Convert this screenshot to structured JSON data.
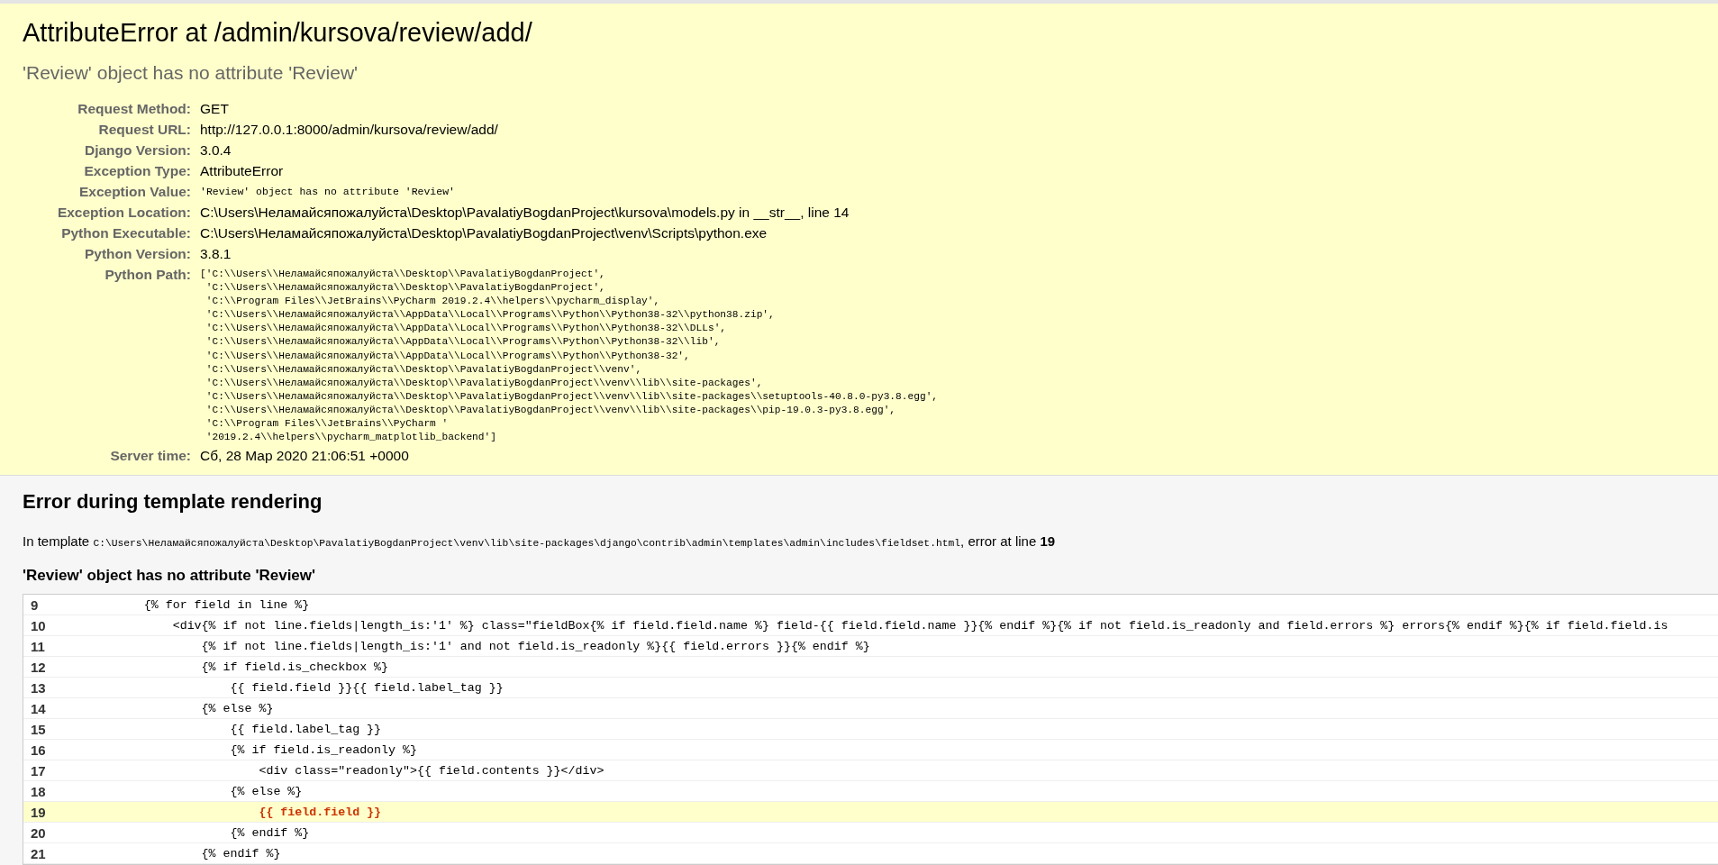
{
  "summary": {
    "title": "AttributeError at /admin/kursova/review/add/",
    "subtitle": "'Review' object has no attribute 'Review'",
    "meta": [
      {
        "label": "Request Method:",
        "kind": "text",
        "value": "GET"
      },
      {
        "label": "Request URL:",
        "kind": "text",
        "value": "http://127.0.0.1:8000/admin/kursova/review/add/"
      },
      {
        "label": "Django Version:",
        "kind": "text",
        "value": "3.0.4"
      },
      {
        "label": "Exception Type:",
        "kind": "text",
        "value": "AttributeError"
      },
      {
        "label": "Exception Value:",
        "kind": "code",
        "value": "'Review' object has no attribute 'Review'"
      },
      {
        "label": "Exception Location:",
        "kind": "text",
        "value": "C:\\Users\\Неламайсяпожалуйста\\Desktop\\PavalatiyBogdanProject\\kursova\\models.py in __str__, line 14"
      },
      {
        "label": "Python Executable:",
        "kind": "text",
        "value": "C:\\Users\\Неламайсяпожалуйста\\Desktop\\PavalatiyBogdanProject\\venv\\Scripts\\python.exe"
      },
      {
        "label": "Python Version:",
        "kind": "text",
        "value": "3.8.1"
      },
      {
        "label": "Python Path:",
        "kind": "lines",
        "lines": [
          "['C:\\\\Users\\\\Неламайсяпожалуйста\\\\Desktop\\\\PavalatiyBogdanProject',",
          " 'C:\\\\Users\\\\Неламайсяпожалуйста\\\\Desktop\\\\PavalatiyBogdanProject',",
          " 'C:\\\\Program Files\\\\JetBrains\\\\PyCharm 2019.2.4\\\\helpers\\\\pycharm_display',",
          " 'C:\\\\Users\\\\Неламайсяпожалуйста\\\\AppData\\\\Local\\\\Programs\\\\Python\\\\Python38-32\\\\python38.zip',",
          " 'C:\\\\Users\\\\Неламайсяпожалуйста\\\\AppData\\\\Local\\\\Programs\\\\Python\\\\Python38-32\\\\DLLs',",
          " 'C:\\\\Users\\\\Неламайсяпожалуйста\\\\AppData\\\\Local\\\\Programs\\\\Python\\\\Python38-32\\\\lib',",
          " 'C:\\\\Users\\\\Неламайсяпожалуйста\\\\AppData\\\\Local\\\\Programs\\\\Python\\\\Python38-32',",
          " 'C:\\\\Users\\\\Неламайсяпожалуйста\\\\Desktop\\\\PavalatiyBogdanProject\\\\venv',",
          " 'C:\\\\Users\\\\Неламайсяпожалуйста\\\\Desktop\\\\PavalatiyBogdanProject\\\\venv\\\\lib\\\\site-packages',",
          " 'C:\\\\Users\\\\Неламайсяпожалуйста\\\\Desktop\\\\PavalatiyBogdanProject\\\\venv\\\\lib\\\\site-packages\\\\setuptools-40.8.0-py3.8.egg',",
          " 'C:\\\\Users\\\\Неламайсяпожалуйста\\\\Desktop\\\\PavalatiyBogdanProject\\\\venv\\\\lib\\\\site-packages\\\\pip-19.0.3-py3.8.egg',",
          " 'C:\\\\Program Files\\\\JetBrains\\\\PyCharm '",
          " '2019.2.4\\\\helpers\\\\pycharm_matplotlib_backend']"
        ]
      },
      {
        "label": "Server time:",
        "kind": "text",
        "value": "Сб, 28 Мар 2020 21:06:51 +0000"
      }
    ]
  },
  "template": {
    "heading": "Error during template rendering",
    "location": {
      "prefix": "In template",
      "path": "C:\\Users\\Неламайсяпожалуйста\\Desktop\\PavalatiyBogdanProject\\venv\\lib\\site-packages\\django\\contrib\\admin\\templates\\admin\\includes\\fieldset.html",
      "suffix": ", error at line",
      "line": "19"
    },
    "message": "'Review' object has no attribute 'Review'",
    "code": [
      {
        "number": "9",
        "text": "            {% for field in line %}",
        "selected": false
      },
      {
        "number": "10",
        "text": "                <div{% if not line.fields|length_is:'1' %} class=\"fieldBox{% if field.field.name %} field-{{ field.field.name }}{% endif %}{% if not field.is_readonly and field.errors %} errors{% endif %}{% if field.field.is",
        "selected": false
      },
      {
        "number": "11",
        "text": "                    {% if not line.fields|length_is:'1' and not field.is_readonly %}{{ field.errors }}{% endif %}",
        "selected": false
      },
      {
        "number": "12",
        "text": "                    {% if field.is_checkbox %}",
        "selected": false
      },
      {
        "number": "13",
        "text": "                        {{ field.field }}{{ field.label_tag }}",
        "selected": false
      },
      {
        "number": "14",
        "text": "                    {% else %}",
        "selected": false
      },
      {
        "number": "15",
        "text": "                        {{ field.label_tag }}",
        "selected": false
      },
      {
        "number": "16",
        "text": "                        {% if field.is_readonly %}",
        "selected": false
      },
      {
        "number": "17",
        "text": "                            <div class=\"readonly\">{{ field.contents }}</div>",
        "selected": false
      },
      {
        "number": "18",
        "text": "                        {% else %}",
        "selected": false
      },
      {
        "number": "19",
        "text": "                            {{ field.field }}",
        "selected": true
      },
      {
        "number": "20",
        "text": "                        {% endif %}",
        "selected": false
      },
      {
        "number": "21",
        "text": "                    {% endif %}",
        "selected": false
      }
    ]
  }
}
